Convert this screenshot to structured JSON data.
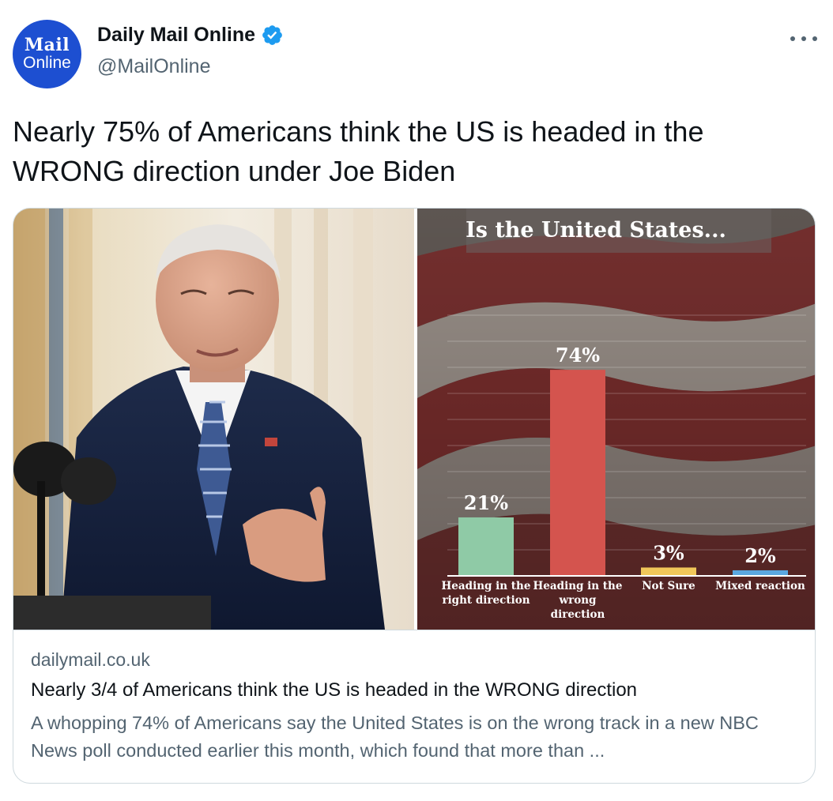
{
  "author": {
    "avatar_line1": "Mail",
    "avatar_line2": "Online",
    "display_name": "Daily Mail Online",
    "handle": "@MailOnline"
  },
  "tweet": {
    "text": "Nearly 75% of Americans think the US is headed in the WRONG direction under Joe Biden"
  },
  "card": {
    "domain": "dailymail.co.uk",
    "title": "Nearly 3/4 of Americans think the US is headed in the WRONG direction",
    "description": "A whopping 74% of Americans say the United States is on the wrong track in a new NBC News poll conducted earlier this month, which found that more than ..."
  },
  "colors": {
    "verified": "#1d9bf0",
    "avatar_bg": "#1d4fd1",
    "secondary_text": "#536471"
  },
  "chart_data": {
    "type": "bar",
    "title": "Is the United States...",
    "categories": [
      [
        "Heading in the",
        "right direction"
      ],
      [
        "Heading in the",
        "wrong",
        "direction"
      ],
      [
        "Not Sure"
      ],
      [
        "Mixed reaction"
      ]
    ],
    "values": [
      21,
      74,
      3,
      2
    ],
    "value_labels": [
      "21%",
      "74%",
      "3%",
      "2%"
    ],
    "bar_colors": [
      "#8fcaa6",
      "#d4544e",
      "#f1c75a",
      "#5aa7e0"
    ],
    "ylim": [
      0,
      100
    ],
    "grid": true
  }
}
